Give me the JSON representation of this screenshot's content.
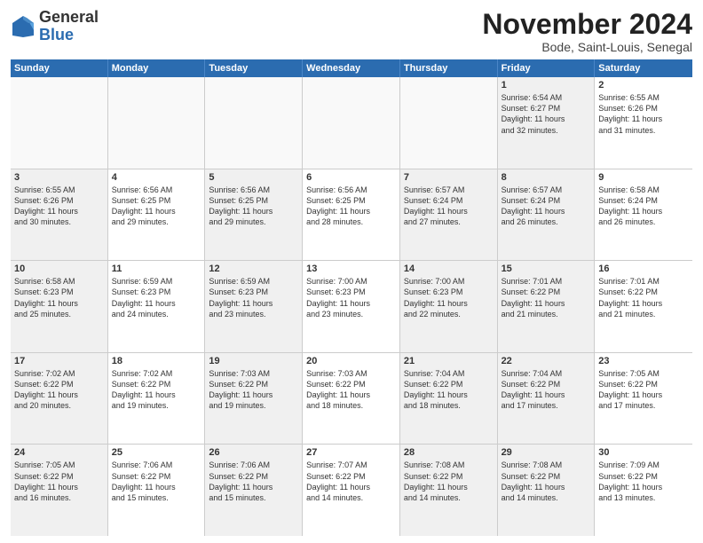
{
  "logo": {
    "line1": "General",
    "line2": "Blue"
  },
  "title": "November 2024",
  "location": "Bode, Saint-Louis, Senegal",
  "days_of_week": [
    "Sunday",
    "Monday",
    "Tuesday",
    "Wednesday",
    "Thursday",
    "Friday",
    "Saturday"
  ],
  "rows": [
    [
      {
        "num": "",
        "info": "",
        "empty": true
      },
      {
        "num": "",
        "info": "",
        "empty": true
      },
      {
        "num": "",
        "info": "",
        "empty": true
      },
      {
        "num": "",
        "info": "",
        "empty": true
      },
      {
        "num": "",
        "info": "",
        "empty": true
      },
      {
        "num": "1",
        "info": "Sunrise: 6:54 AM\nSunset: 6:27 PM\nDaylight: 11 hours\nand 32 minutes.",
        "shaded": true
      },
      {
        "num": "2",
        "info": "Sunrise: 6:55 AM\nSunset: 6:26 PM\nDaylight: 11 hours\nand 31 minutes."
      }
    ],
    [
      {
        "num": "3",
        "info": "Sunrise: 6:55 AM\nSunset: 6:26 PM\nDaylight: 11 hours\nand 30 minutes.",
        "shaded": true
      },
      {
        "num": "4",
        "info": "Sunrise: 6:56 AM\nSunset: 6:25 PM\nDaylight: 11 hours\nand 29 minutes."
      },
      {
        "num": "5",
        "info": "Sunrise: 6:56 AM\nSunset: 6:25 PM\nDaylight: 11 hours\nand 29 minutes.",
        "shaded": true
      },
      {
        "num": "6",
        "info": "Sunrise: 6:56 AM\nSunset: 6:25 PM\nDaylight: 11 hours\nand 28 minutes."
      },
      {
        "num": "7",
        "info": "Sunrise: 6:57 AM\nSunset: 6:24 PM\nDaylight: 11 hours\nand 27 minutes.",
        "shaded": true
      },
      {
        "num": "8",
        "info": "Sunrise: 6:57 AM\nSunset: 6:24 PM\nDaylight: 11 hours\nand 26 minutes.",
        "shaded": true
      },
      {
        "num": "9",
        "info": "Sunrise: 6:58 AM\nSunset: 6:24 PM\nDaylight: 11 hours\nand 26 minutes."
      }
    ],
    [
      {
        "num": "10",
        "info": "Sunrise: 6:58 AM\nSunset: 6:23 PM\nDaylight: 11 hours\nand 25 minutes.",
        "shaded": true
      },
      {
        "num": "11",
        "info": "Sunrise: 6:59 AM\nSunset: 6:23 PM\nDaylight: 11 hours\nand 24 minutes."
      },
      {
        "num": "12",
        "info": "Sunrise: 6:59 AM\nSunset: 6:23 PM\nDaylight: 11 hours\nand 23 minutes.",
        "shaded": true
      },
      {
        "num": "13",
        "info": "Sunrise: 7:00 AM\nSunset: 6:23 PM\nDaylight: 11 hours\nand 23 minutes."
      },
      {
        "num": "14",
        "info": "Sunrise: 7:00 AM\nSunset: 6:23 PM\nDaylight: 11 hours\nand 22 minutes.",
        "shaded": true
      },
      {
        "num": "15",
        "info": "Sunrise: 7:01 AM\nSunset: 6:22 PM\nDaylight: 11 hours\nand 21 minutes.",
        "shaded": true
      },
      {
        "num": "16",
        "info": "Sunrise: 7:01 AM\nSunset: 6:22 PM\nDaylight: 11 hours\nand 21 minutes."
      }
    ],
    [
      {
        "num": "17",
        "info": "Sunrise: 7:02 AM\nSunset: 6:22 PM\nDaylight: 11 hours\nand 20 minutes.",
        "shaded": true
      },
      {
        "num": "18",
        "info": "Sunrise: 7:02 AM\nSunset: 6:22 PM\nDaylight: 11 hours\nand 19 minutes."
      },
      {
        "num": "19",
        "info": "Sunrise: 7:03 AM\nSunset: 6:22 PM\nDaylight: 11 hours\nand 19 minutes.",
        "shaded": true
      },
      {
        "num": "20",
        "info": "Sunrise: 7:03 AM\nSunset: 6:22 PM\nDaylight: 11 hours\nand 18 minutes."
      },
      {
        "num": "21",
        "info": "Sunrise: 7:04 AM\nSunset: 6:22 PM\nDaylight: 11 hours\nand 18 minutes.",
        "shaded": true
      },
      {
        "num": "22",
        "info": "Sunrise: 7:04 AM\nSunset: 6:22 PM\nDaylight: 11 hours\nand 17 minutes.",
        "shaded": true
      },
      {
        "num": "23",
        "info": "Sunrise: 7:05 AM\nSunset: 6:22 PM\nDaylight: 11 hours\nand 17 minutes."
      }
    ],
    [
      {
        "num": "24",
        "info": "Sunrise: 7:05 AM\nSunset: 6:22 PM\nDaylight: 11 hours\nand 16 minutes.",
        "shaded": true
      },
      {
        "num": "25",
        "info": "Sunrise: 7:06 AM\nSunset: 6:22 PM\nDaylight: 11 hours\nand 15 minutes."
      },
      {
        "num": "26",
        "info": "Sunrise: 7:06 AM\nSunset: 6:22 PM\nDaylight: 11 hours\nand 15 minutes.",
        "shaded": true
      },
      {
        "num": "27",
        "info": "Sunrise: 7:07 AM\nSunset: 6:22 PM\nDaylight: 11 hours\nand 14 minutes."
      },
      {
        "num": "28",
        "info": "Sunrise: 7:08 AM\nSunset: 6:22 PM\nDaylight: 11 hours\nand 14 minutes.",
        "shaded": true
      },
      {
        "num": "29",
        "info": "Sunrise: 7:08 AM\nSunset: 6:22 PM\nDaylight: 11 hours\nand 14 minutes.",
        "shaded": true
      },
      {
        "num": "30",
        "info": "Sunrise: 7:09 AM\nSunset: 6:22 PM\nDaylight: 11 hours\nand 13 minutes."
      }
    ]
  ]
}
